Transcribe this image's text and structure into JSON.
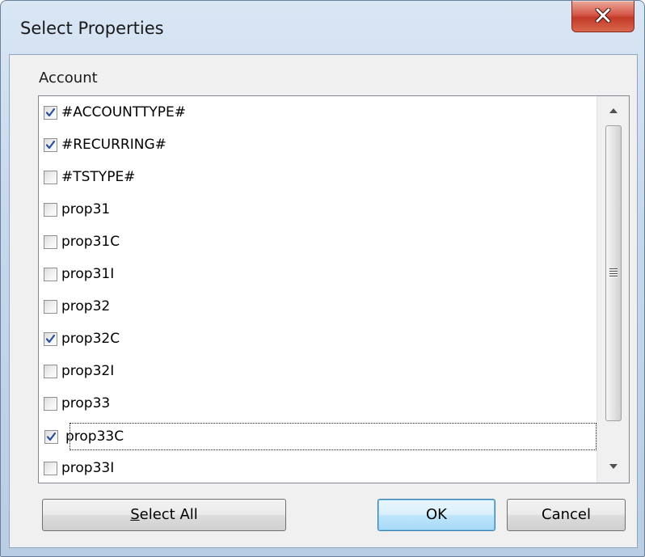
{
  "window": {
    "title": "Select Properties",
    "close_icon": "close-icon"
  },
  "group": {
    "label": "Account"
  },
  "list": {
    "items": [
      {
        "label": "#ACCOUNTTYPE#",
        "checked": true
      },
      {
        "label": "#RECURRING#",
        "checked": true
      },
      {
        "label": "#TSTYPE#",
        "checked": false
      },
      {
        "label": "prop31",
        "checked": false
      },
      {
        "label": "prop31C",
        "checked": false
      },
      {
        "label": "prop31I",
        "checked": false
      },
      {
        "label": "prop32",
        "checked": false
      },
      {
        "label": "prop32C",
        "checked": true
      },
      {
        "label": "prop32I",
        "checked": false
      },
      {
        "label": "prop33",
        "checked": false
      },
      {
        "label": "prop33C",
        "checked": true,
        "focused": true
      },
      {
        "label": "prop33I",
        "checked": false
      }
    ],
    "scrollbar": {
      "up_icon": "scroll-up-arrow-icon",
      "down_icon": "scroll-down-arrow-icon",
      "grip_icon": "scroll-grip-icon"
    }
  },
  "buttons": {
    "select_all_mnemonic": "S",
    "select_all_rest": "elect All",
    "ok": "OK",
    "cancel": "Cancel"
  },
  "colors": {
    "default_button_border": "#3c7fb1",
    "close_button": "#c23a27",
    "check_mark": "#2a4f9c"
  }
}
